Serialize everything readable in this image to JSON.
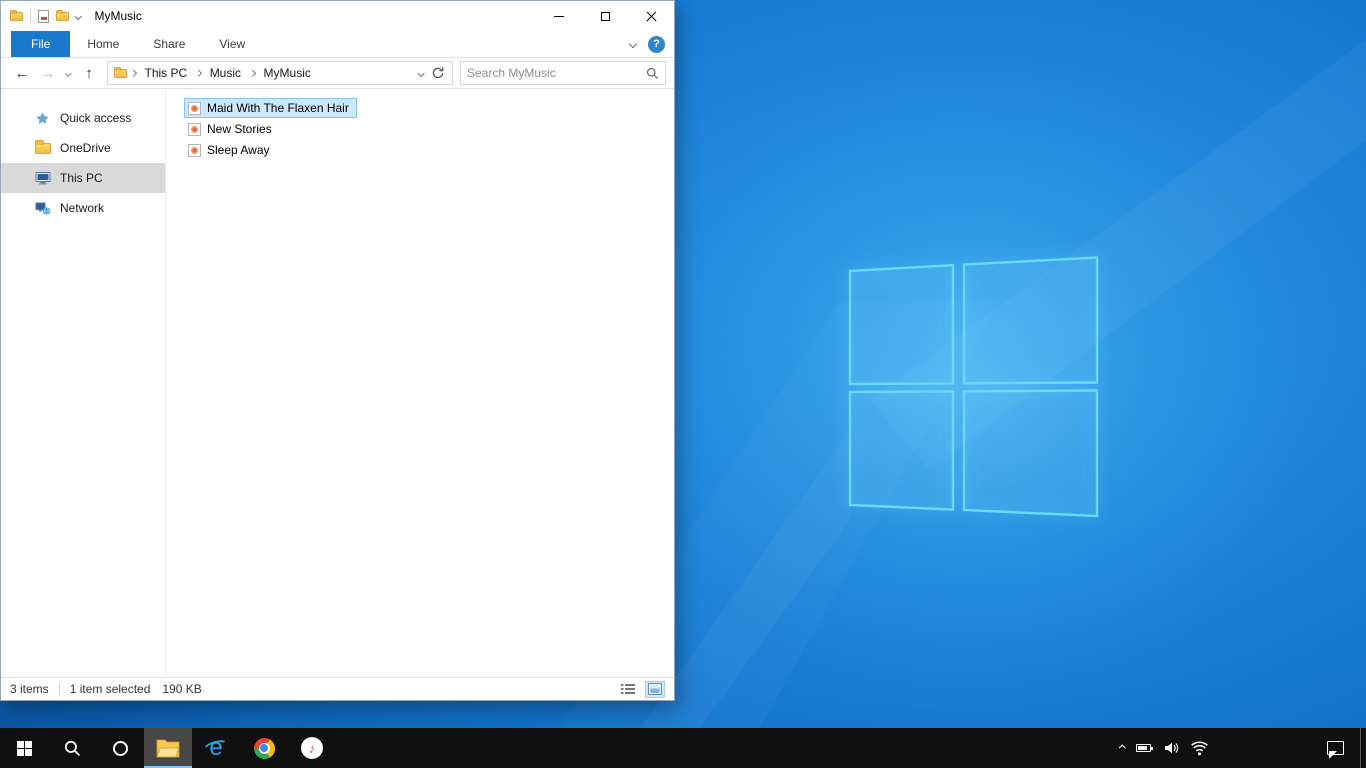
{
  "window": {
    "title": "MyMusic"
  },
  "ribbon": {
    "tabs": [
      {
        "label": "File",
        "active": true
      },
      {
        "label": "Home",
        "active": false
      },
      {
        "label": "Share",
        "active": false
      },
      {
        "label": "View",
        "active": false
      }
    ],
    "help_label": "?"
  },
  "navigation": {
    "back": "←",
    "forward": "→",
    "up": "↑"
  },
  "address": {
    "breadcrumb": [
      "This PC",
      "Music",
      "MyMusic"
    ],
    "search_placeholder": "Search MyMusic"
  },
  "sidebar": {
    "items": [
      {
        "label": "Quick access",
        "icon": "star-icon",
        "selected": false
      },
      {
        "label": "OneDrive",
        "icon": "onedrive-folder-icon",
        "selected": false
      },
      {
        "label": "This PC",
        "icon": "computer-icon",
        "selected": true
      },
      {
        "label": "Network",
        "icon": "network-icon",
        "selected": false
      }
    ]
  },
  "files": [
    {
      "name": "Maid With The Flaxen Hair",
      "icon": "music-file-icon",
      "selected": true
    },
    {
      "name": "New Stories",
      "icon": "music-file-icon",
      "selected": false
    },
    {
      "name": "Sleep Away",
      "icon": "music-file-icon",
      "selected": false
    }
  ],
  "statusbar": {
    "count": "3 items",
    "selection": "1 item selected",
    "size": "190 KB"
  },
  "taskbar_icons": [
    "start",
    "search",
    "cortana",
    "file-explorer",
    "internet-explorer",
    "chrome",
    "itunes"
  ],
  "tray_icons": [
    "hidden-icons-chevron",
    "battery",
    "volume",
    "wifi",
    "action-center"
  ],
  "colors": {
    "accent_blue": "#1979ca",
    "selection_fill": "#cce8ff",
    "selection_border": "#84c3f2",
    "sidebar_selection": "#d9d9d9",
    "taskbar": "#101010",
    "wallpaper_base": "#0c61b4",
    "logo_glow": "#69d9ff"
  }
}
